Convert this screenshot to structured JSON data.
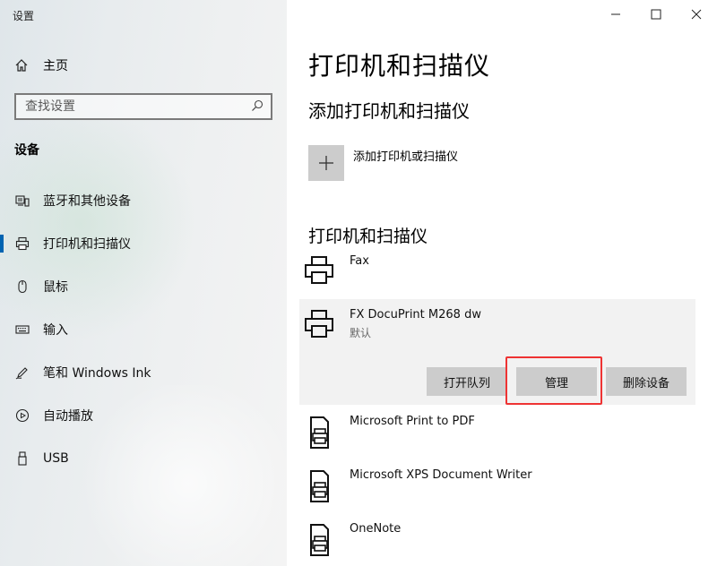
{
  "window": {
    "app_title": "设置",
    "controls": {
      "minimize": "—",
      "maximize": "☐",
      "close": "✕"
    }
  },
  "sidebar": {
    "home_label": "主页",
    "search_placeholder": "查找设置",
    "section_title": "设备",
    "items": [
      {
        "label": "蓝牙和其他设备",
        "icon": "bluetooth-devices-icon",
        "active": false
      },
      {
        "label": "打印机和扫描仪",
        "icon": "printer-icon",
        "active": true
      },
      {
        "label": "鼠标",
        "icon": "mouse-icon",
        "active": false
      },
      {
        "label": "输入",
        "icon": "keyboard-icon",
        "active": false
      },
      {
        "label": "笔和 Windows Ink",
        "icon": "pen-icon",
        "active": false
      },
      {
        "label": "自动播放",
        "icon": "autoplay-icon",
        "active": false
      },
      {
        "label": "USB",
        "icon": "usb-icon",
        "active": false
      }
    ]
  },
  "main": {
    "title": "打印机和扫描仪",
    "add_section_title": "添加打印机和扫描仪",
    "add_label": "添加打印机或扫描仪",
    "list_section_title": "打印机和扫描仪",
    "printers": [
      {
        "name": "Fax",
        "status": ""
      },
      {
        "name": "FX DocuPrint M268 dw",
        "status": "默认",
        "selected": true
      },
      {
        "name": "Microsoft Print to PDF",
        "status": ""
      },
      {
        "name": "Microsoft XPS Document Writer",
        "status": ""
      },
      {
        "name": "OneNote",
        "status": ""
      }
    ],
    "actions": {
      "open_queue": "打开队列",
      "manage": "管理",
      "remove": "删除设备"
    }
  },
  "colors": {
    "accent": "#0063b1",
    "button_bg": "#cccccc",
    "selected_bg": "#f2f2f2",
    "highlight": "#e33333"
  }
}
